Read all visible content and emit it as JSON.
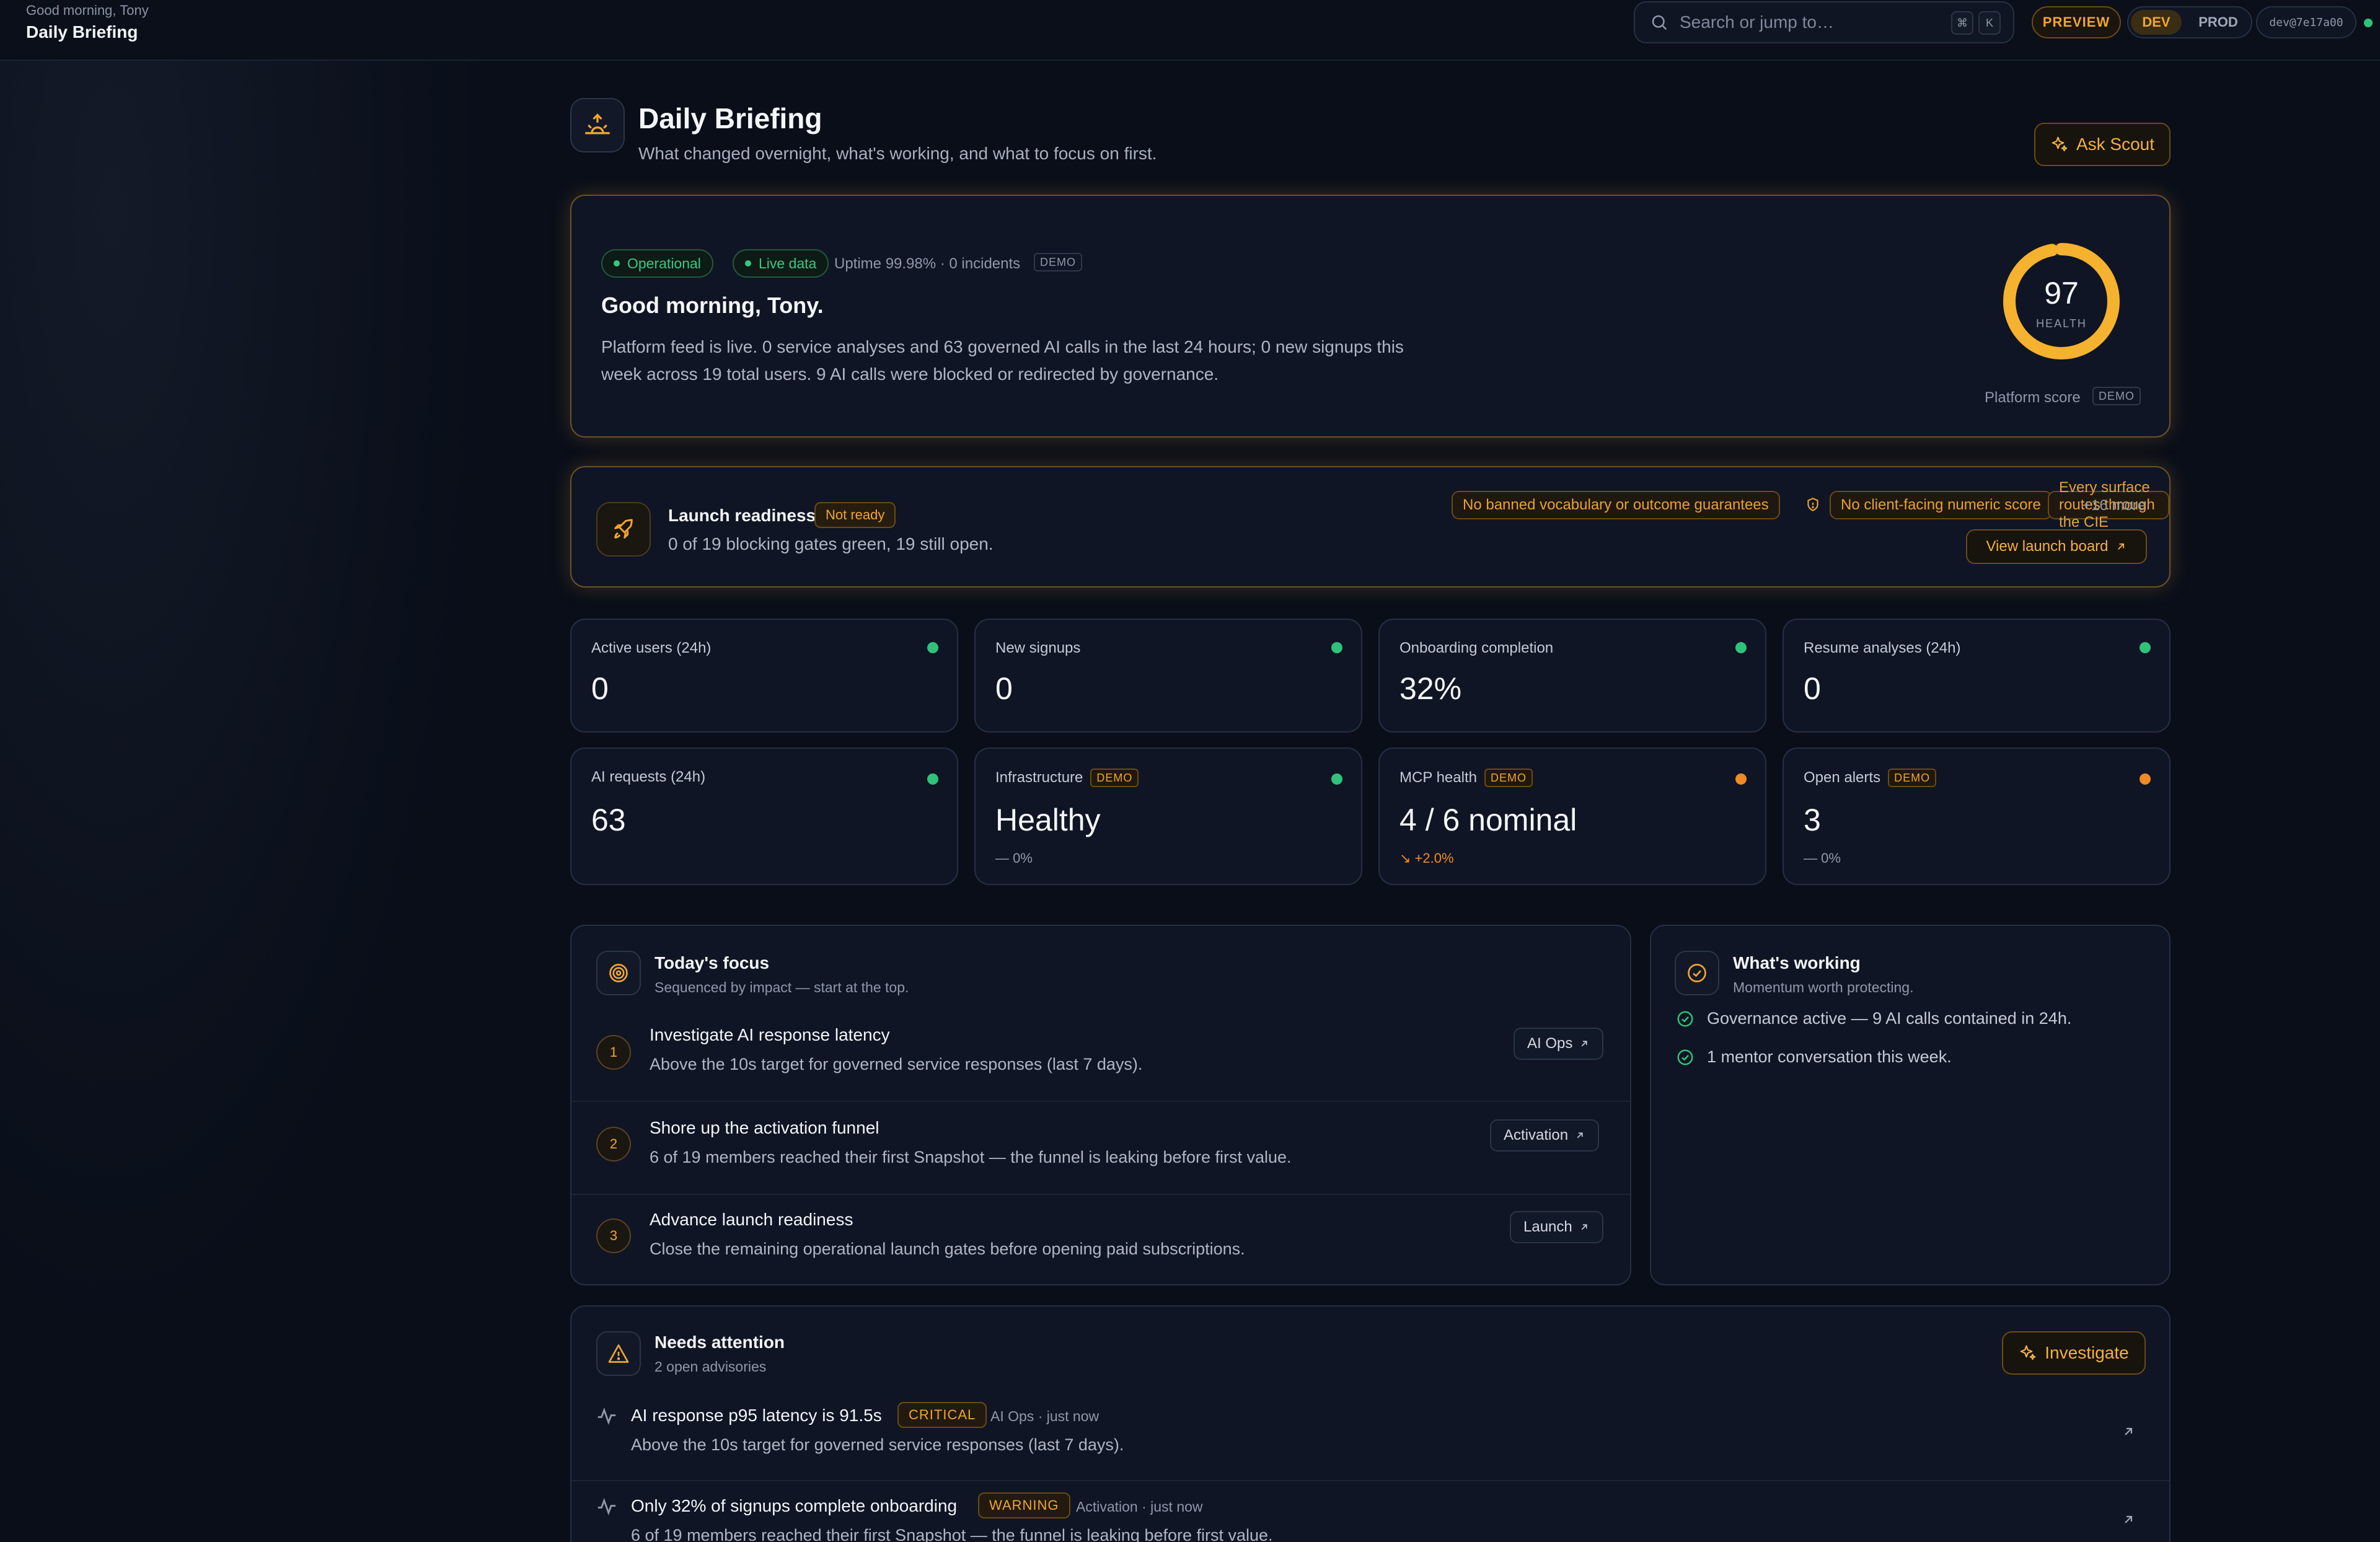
{
  "topbar": {
    "greeting": "Good morning, Tony",
    "title": "Daily Briefing",
    "search_placeholder": "Search or jump to…",
    "kbd_mod": "⌘",
    "kbd_key": "K",
    "preview_label": "PREVIEW",
    "env_dev": "DEV",
    "env_prod": "PROD",
    "dev_id": "dev@7e17a00"
  },
  "header": {
    "title": "Daily Briefing",
    "subtitle": "What changed overnight, what's working, and what to focus on first.",
    "ask_label": "Ask Scout"
  },
  "hero": {
    "status": "Operational",
    "live": "Live data",
    "uptime": "Uptime 99.98% · 0 incidents",
    "demo": "DEMO",
    "greeting": "Good morning, Tony.",
    "summary": "Platform feed is live. 0 service analyses and 63 governed AI calls in the last 24 hours; 0 new signups this week across 19 total users. 9 AI calls were blocked or redirected by governance.",
    "health_score": "97",
    "health_fraction": 0.97,
    "health_label": "HEALTH",
    "platform_score": "Platform score",
    "platform_demo": "DEMO"
  },
  "launch": {
    "title": "Launch readiness",
    "status": "Not ready",
    "subtitle": "0 of 19 blocking gates green, 19 still open.",
    "chips": [
      "No client-facing numeric score",
      "No banned vocabulary or outcome guarantees",
      "Every surface routes through the CIE"
    ],
    "more": "+16 more",
    "view_label": "View launch board"
  },
  "kpis": [
    {
      "label": "Active users (24h)",
      "value": "0",
      "demo": "",
      "delta": "",
      "status_color": "#2fc27a"
    },
    {
      "label": "New signups",
      "value": "0",
      "demo": "",
      "delta": "",
      "status_color": "#2fc27a"
    },
    {
      "label": "Onboarding completion",
      "value": "32%",
      "demo": "",
      "delta": "",
      "status_color": "#2fc27a"
    },
    {
      "label": "Resume analyses (24h)",
      "value": "0",
      "demo": "",
      "delta": "",
      "status_color": "#2fc27a"
    },
    {
      "label": "AI requests (24h)",
      "value": "63",
      "demo": "",
      "delta": "",
      "status_color": "#2fc27a"
    },
    {
      "label": "Infrastructure",
      "value": "Healthy",
      "demo": "DEMO",
      "delta": "— 0%",
      "status_color": "#2fc27a"
    },
    {
      "label": "MCP health",
      "value": "4 / 6 nominal",
      "demo": "DEMO",
      "delta": "↘ +2.0%",
      "status_color": "#f08a24"
    },
    {
      "label": "Open alerts",
      "value": "3",
      "demo": "DEMO",
      "delta": "— 0%",
      "status_color": "#f08a24"
    }
  ],
  "focus": {
    "title": "Today's focus",
    "subtitle": "Sequenced by impact — start at the top.",
    "items": [
      {
        "num": "1",
        "title": "Investigate AI response latency",
        "desc": "Above the 10s target for governed service responses (last 7 days).",
        "tag": "AI Ops"
      },
      {
        "num": "2",
        "title": "Shore up the activation funnel",
        "desc": "6 of 19 members reached their first Snapshot — the funnel is leaking before first value.",
        "tag": "Activation"
      },
      {
        "num": "3",
        "title": "Advance launch readiness",
        "desc": "Close the remaining operational launch gates before opening paid subscriptions.",
        "tag": "Launch"
      }
    ]
  },
  "working": {
    "title": "What's working",
    "subtitle": "Momentum worth protecting.",
    "items": [
      "Governance active — 9 AI calls contained in 24h.",
      "1 mentor conversation this week."
    ]
  },
  "attention": {
    "title": "Needs attention",
    "subtitle": "2 open advisories",
    "investigate_label": "Investigate",
    "alerts": [
      {
        "title": "AI response p95 latency is 91.5s",
        "severity": "CRITICAL",
        "meta": "AI Ops · just now",
        "desc": "Above the 10s target for governed service responses (last 7 days)."
      },
      {
        "title": "Only 32% of signups complete onboarding",
        "severity": "WARNING",
        "meta": "Activation · just now",
        "desc": "6 of 19 members reached their first Snapshot — the funnel is leaking before first value."
      }
    ]
  },
  "colors": {
    "accent": "#f0a531",
    "success": "#2fc27a",
    "warning": "#f08a24",
    "background": "#090e19"
  }
}
